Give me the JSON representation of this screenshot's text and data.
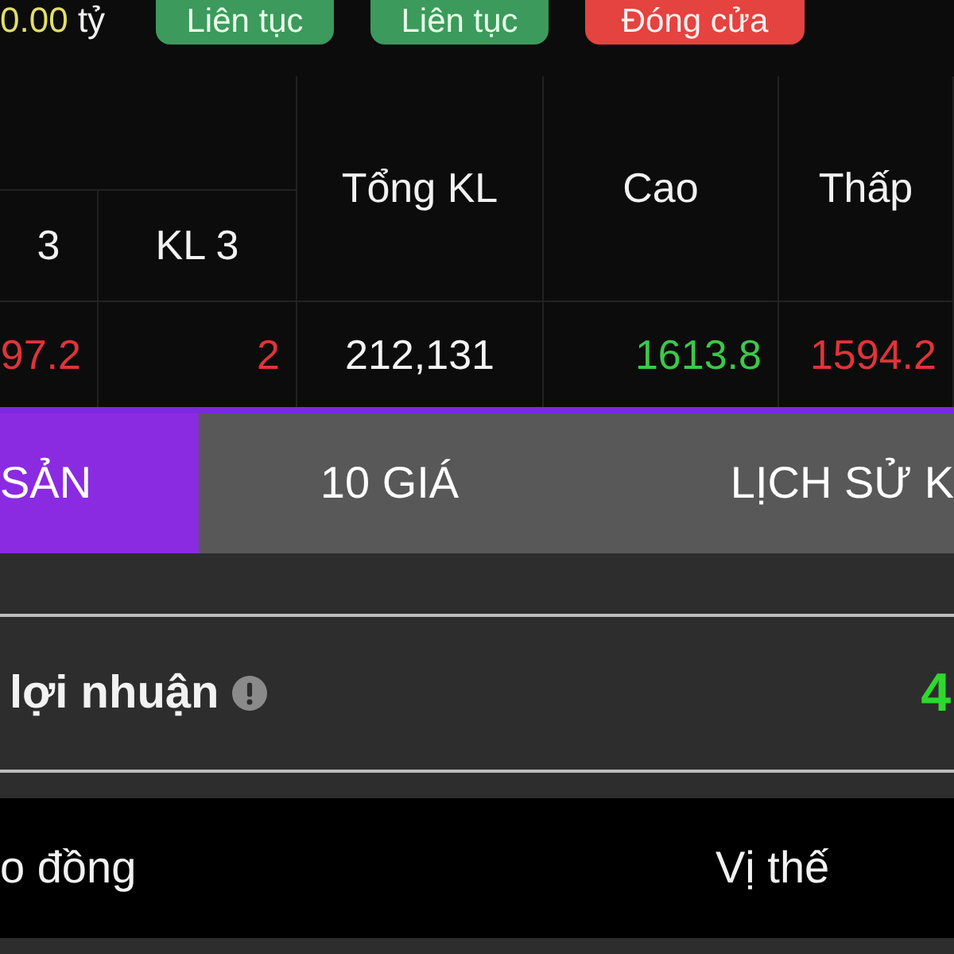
{
  "summary": {
    "value": "0.00",
    "unit": "tỷ",
    "badges": [
      {
        "label": "Liên tục",
        "kind": "open"
      },
      {
        "label": "Liên tục",
        "kind": "open"
      },
      {
        "label": "Đóng cửa",
        "kind": "closed"
      }
    ]
  },
  "table": {
    "columns": [
      "3",
      "KL 3",
      "Tổng KL",
      "Cao",
      "Thấp"
    ],
    "rows": [
      [
        {
          "text": "97.2",
          "color": "#e0343a"
        },
        {
          "text": "2",
          "color": "#e0343a"
        },
        {
          "text": "212,131",
          "color": "#f4f4f4"
        },
        {
          "text": "1613.8",
          "color": "#3cc84a"
        },
        {
          "text": "1594.2",
          "color": "#e0343a"
        }
      ]
    ]
  },
  "tabs": [
    {
      "label": "SẢN",
      "selected": true
    },
    {
      "label": "10 GIÁ",
      "selected": false
    },
    {
      "label": "LỊCH SỬ K",
      "selected": false
    }
  ],
  "profit": {
    "label": "lợi nhuận",
    "value": "4"
  },
  "positions": {
    "columns": [
      "o đồng",
      "Vị thế"
    ]
  }
}
